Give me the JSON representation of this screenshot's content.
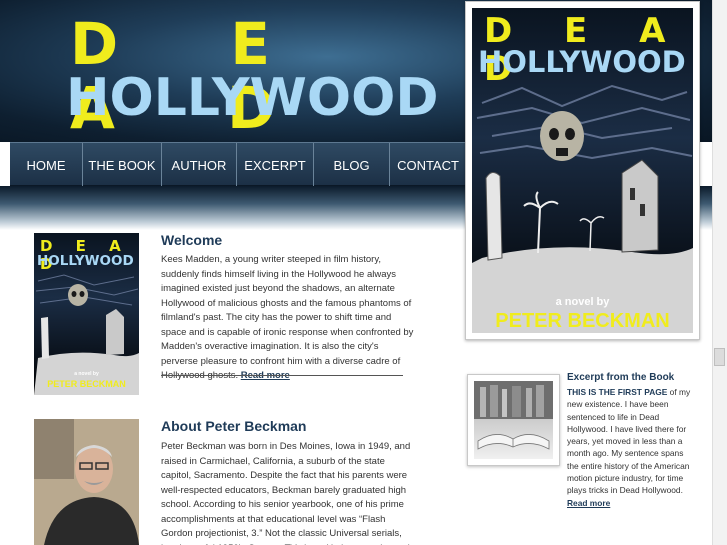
{
  "logo": {
    "line1": "D E A D",
    "line2": "HOLLYWOOD"
  },
  "nav": [
    "HOME",
    "THE BOOK",
    "AUTHOR",
    "EXCERPT",
    "BLOG",
    "CONTACT"
  ],
  "cover": {
    "line1": "D E A D",
    "line2": "HOLLYWOOD",
    "subtitle": "a novel by",
    "author": "PETER BECKMAN"
  },
  "welcome": {
    "heading": "Welcome",
    "body": "Kees Madden, a young writer steeped in film history, suddenly finds himself living in the Hollywood he always imagined existed just beyond the shadows, an alternate Hollywood of malicious ghosts and the famous phantoms of filmland's past. The city has the power to shift time and space and is capable of ironic response when confronted by Madden's overactive imagination. It is also the city's perverse pleasure to confront him with a diverse cadre of Hollywood ghosts. ",
    "read_more": "Read more"
  },
  "about": {
    "heading": "About Peter Beckman",
    "body": "Peter Beckman was born in Des Moines, Iowa in 1949, and raised in Carmichael, California, a suburb of the state capitol, Sacramento. Despite the fact that his parents were well-respected educators, Beckman barely graduated high school. According to his senior yearbook, one of his prime accomplishments at that educational level was “Flash Gordon projectionist, 3.” Not the classic Universal serials, but the awful 1950's German TV show. He is currently much more serious"
  },
  "excerpt": {
    "heading": "Excerpt from the Book",
    "lead": "THIS IS THE FIRST PAGE",
    "body": " of my new existence. I have been sentenced to life in Dead Hollywood. I have lived there for years, yet moved in less than a month ago. My sentence spans the entire history of the American motion picture industry, for time plays tricks in Dead Hollywood.",
    "read_more": "Read more"
  }
}
